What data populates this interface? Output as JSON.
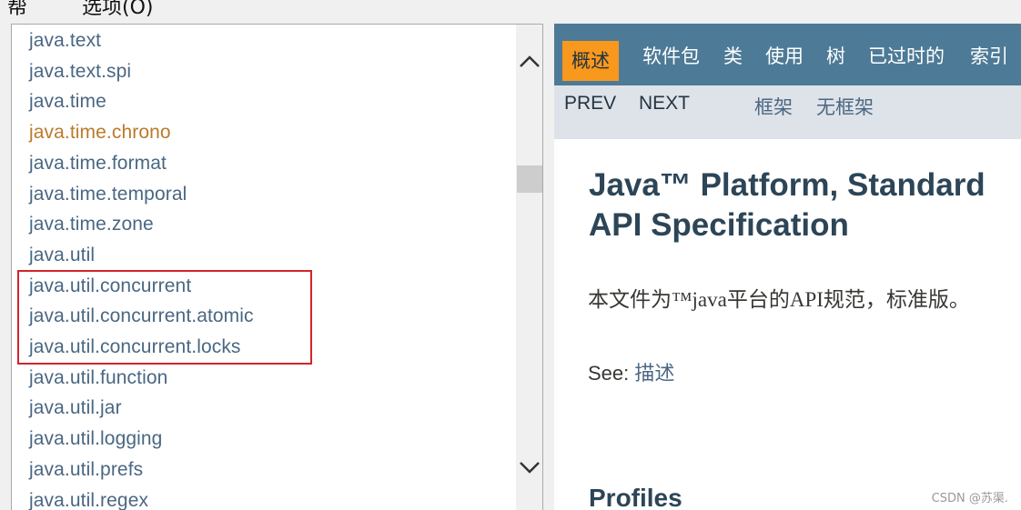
{
  "menubar": {
    "left": "帮",
    "options": "选项(O)"
  },
  "packages": [
    {
      "name": "java.text",
      "visited": false
    },
    {
      "name": "java.text.spi",
      "visited": false
    },
    {
      "name": "java.time",
      "visited": false
    },
    {
      "name": "java.time.chrono",
      "visited": true
    },
    {
      "name": "java.time.format",
      "visited": false
    },
    {
      "name": "java.time.temporal",
      "visited": false
    },
    {
      "name": "java.time.zone",
      "visited": false
    },
    {
      "name": "java.util",
      "visited": false
    },
    {
      "name": "java.util.concurrent",
      "visited": false
    },
    {
      "name": "java.util.concurrent.atomic",
      "visited": false
    },
    {
      "name": "java.util.concurrent.locks",
      "visited": false
    },
    {
      "name": "java.util.function",
      "visited": false
    },
    {
      "name": "java.util.jar",
      "visited": false
    },
    {
      "name": "java.util.logging",
      "visited": false
    },
    {
      "name": "java.util.prefs",
      "visited": false
    },
    {
      "name": "java.util.regex",
      "visited": false
    }
  ],
  "nav": {
    "overview": "概述",
    "package": "软件包",
    "class": "类",
    "use": "使用",
    "tree": "树",
    "deprecated": "已过时的",
    "index": "索引"
  },
  "subnav": {
    "prev": "PREV",
    "next": "NEXT",
    "frames": "框架",
    "no_frames": "无框架"
  },
  "content": {
    "title_line1": "Java™ Platform, Standard",
    "title_line2": "API Specification",
    "description": "本文件为™java平台的API规范，标准版。",
    "see_label": "See:",
    "see_link": "描述",
    "profiles_heading": "Profiles"
  },
  "watermark": "CSDN @苏渠.",
  "colors": {
    "nav_bg": "#4d7a97",
    "nav_active": "#f8981d",
    "subnav_bg": "#dee3e9",
    "link": "#4a6782",
    "visited_link": "#bb7a2a",
    "highlight": "#d4242b"
  }
}
